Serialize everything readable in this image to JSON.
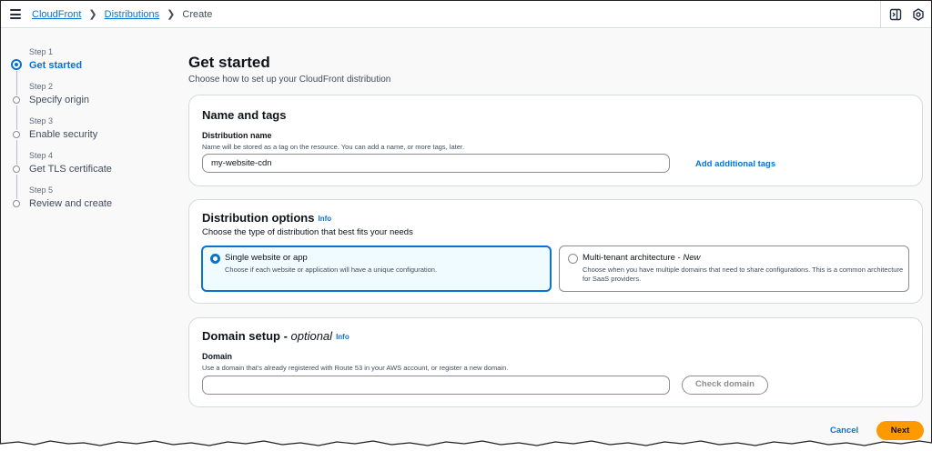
{
  "breadcrumbs": {
    "item1": "CloudFront",
    "item2": "Distributions",
    "current": "Create"
  },
  "steps": [
    {
      "number": "Step 1",
      "label": "Get started",
      "active": true
    },
    {
      "number": "Step 2",
      "label": "Specify origin",
      "active": false
    },
    {
      "number": "Step 3",
      "label": "Enable security",
      "active": false
    },
    {
      "number": "Step 4",
      "label": "Get TLS certificate",
      "active": false
    },
    {
      "number": "Step 5",
      "label": "Review and create",
      "active": false
    }
  ],
  "page": {
    "title": "Get started",
    "description": "Choose how to set up your CloudFront distribution"
  },
  "name_tags": {
    "title": "Name and tags",
    "field_label": "Distribution name",
    "field_desc": "Name will be stored as a tag on the resource. You can add a name, or more tags, later.",
    "field_value": "my-website-cdn",
    "add_tags_label": "Add additional tags"
  },
  "distribution_options": {
    "title": "Distribution options",
    "info": "Info",
    "description": "Choose the type of distribution that best fits your needs",
    "option1_title": "Single website or app",
    "option1_desc": "Choose if each website or application will have a unique configuration.",
    "option2_title": "Multi-tenant architecture - ",
    "option2_title_em": "New",
    "option2_desc": "Choose when you have multiple domains that need to share configurations. This is a common architecture for SaaS providers."
  },
  "domain_setup": {
    "title": "Domain setup - ",
    "title_em": "optional",
    "info": "Info",
    "field_label": "Domain",
    "field_desc": "Use a domain that's already registered with Route 53 in your AWS account, or register a new domain.",
    "field_value": "",
    "check_label": "Check domain"
  },
  "footer": {
    "cancel_label": "Cancel",
    "next_label": "Next"
  },
  "colors": {
    "accent": "#0972d3",
    "primary_button": "#ff9900",
    "text": "#0f141a"
  }
}
